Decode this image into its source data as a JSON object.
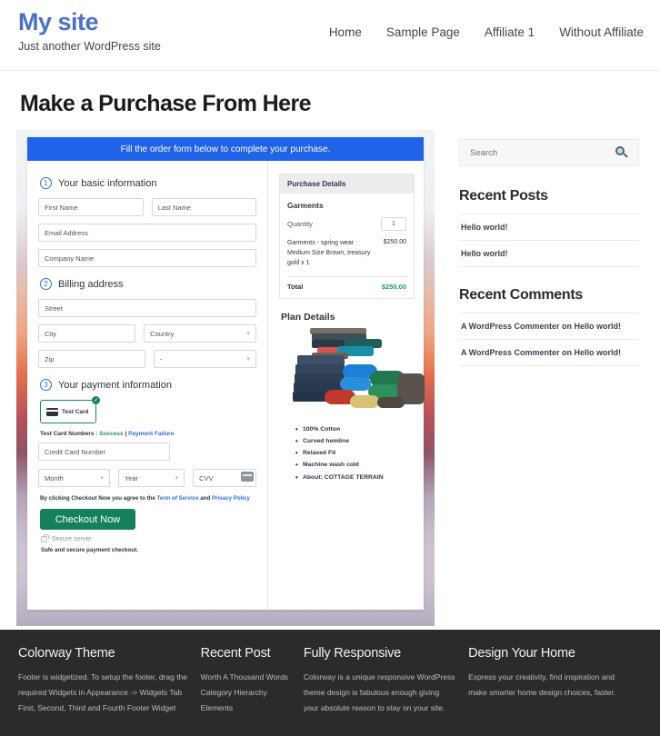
{
  "header": {
    "site_title": "My site",
    "tagline": "Just another WordPress site",
    "nav": [
      {
        "label": "Home"
      },
      {
        "label": "Sample Page"
      },
      {
        "label": "Affiliate 1"
      },
      {
        "label": "Without Affiliate"
      }
    ]
  },
  "main": {
    "page_title": "Make a Purchase From Here",
    "form": {
      "banner": "Fill the order form below to complete your purchase.",
      "step1": {
        "number": "1",
        "label": "Your basic information"
      },
      "step2": {
        "number": "2",
        "label": "Billing address"
      },
      "step3": {
        "number": "3",
        "label": "Your payment information"
      },
      "fields": {
        "first_name": "First Name",
        "last_name": "Last Name",
        "email": "Email Address",
        "company": "Company Name",
        "street": "Street",
        "city": "City",
        "country": "Country",
        "zip": "Zip",
        "state": "-",
        "card_number": "Credit Card Number",
        "month": "Month",
        "year": "Year",
        "cvv": "CVV"
      },
      "payment_option": {
        "label": "Test  Card",
        "selected_mark": "✓"
      },
      "test_cards": {
        "prefix": "Test Card Numbers : ",
        "success": "Success",
        "separator": " | ",
        "failure": "Payment Failure"
      },
      "agreement": {
        "before": "By clicking Checkout Now you agree to the ",
        "terms": "Term of Service",
        "middle": " and ",
        "privacy": "Privacy Policy"
      },
      "checkout_button": "Checkout Now",
      "secure_server": "Secure server",
      "safe_note": "Safe and secure payment checkout."
    },
    "purchase_details": {
      "heading": "Purchase Details",
      "product_group": "Garments",
      "quantity_label": "Quantity",
      "quantity_value": "1",
      "item_description": "Garments - spring wear Medium Size Brown, treasury gold x 1",
      "item_price": "$250.00",
      "total_label": "Total",
      "total_value": "$250.00"
    },
    "plan_details": {
      "title": "Plan Details",
      "features": [
        "100% Cotton",
        "Curved hemline",
        "Relaxed Fit",
        "Machine wash cold",
        "About: COTTAGE TERRAIN"
      ]
    }
  },
  "sidebar": {
    "search": {
      "placeholder": "Search",
      "icon": "search-icon"
    },
    "recent_posts": {
      "title": "Recent Posts",
      "items": [
        "Hello world!",
        "Hello world!"
      ]
    },
    "recent_comments": {
      "title": "Recent Comments",
      "items": [
        "A WordPress Commenter on Hello world!",
        "A WordPress Commenter on Hello world!"
      ]
    }
  },
  "footer": {
    "columns": [
      {
        "title": "Colorway Theme",
        "text": "Footer is widgetized. To setup the footer, drag the required Widgets in Appearance -> Widgets Tab First, Second, Third and Fourth Footer Widget",
        "links": []
      },
      {
        "title": "Recent Post",
        "text": "",
        "links": [
          "Worth A Thousand Words",
          "Category Hierarchy",
          "Elements"
        ]
      },
      {
        "title": "Fully Responsive",
        "text": "Colorway is a unique responsive WordPress theme design is fabulous enough giving your absolute reason to stay on your site.",
        "links": []
      },
      {
        "title": "Design Your Home",
        "text": "Express your creativity, find inspiration and make smarter home design choices, faster.",
        "links": []
      }
    ]
  },
  "colors": {
    "brand_blue": "#4a72c4",
    "banner_blue": "#1f63e8",
    "accent_green": "#15815a",
    "total_green": "#17a45f",
    "footer_bg": "#2b2b2b"
  }
}
